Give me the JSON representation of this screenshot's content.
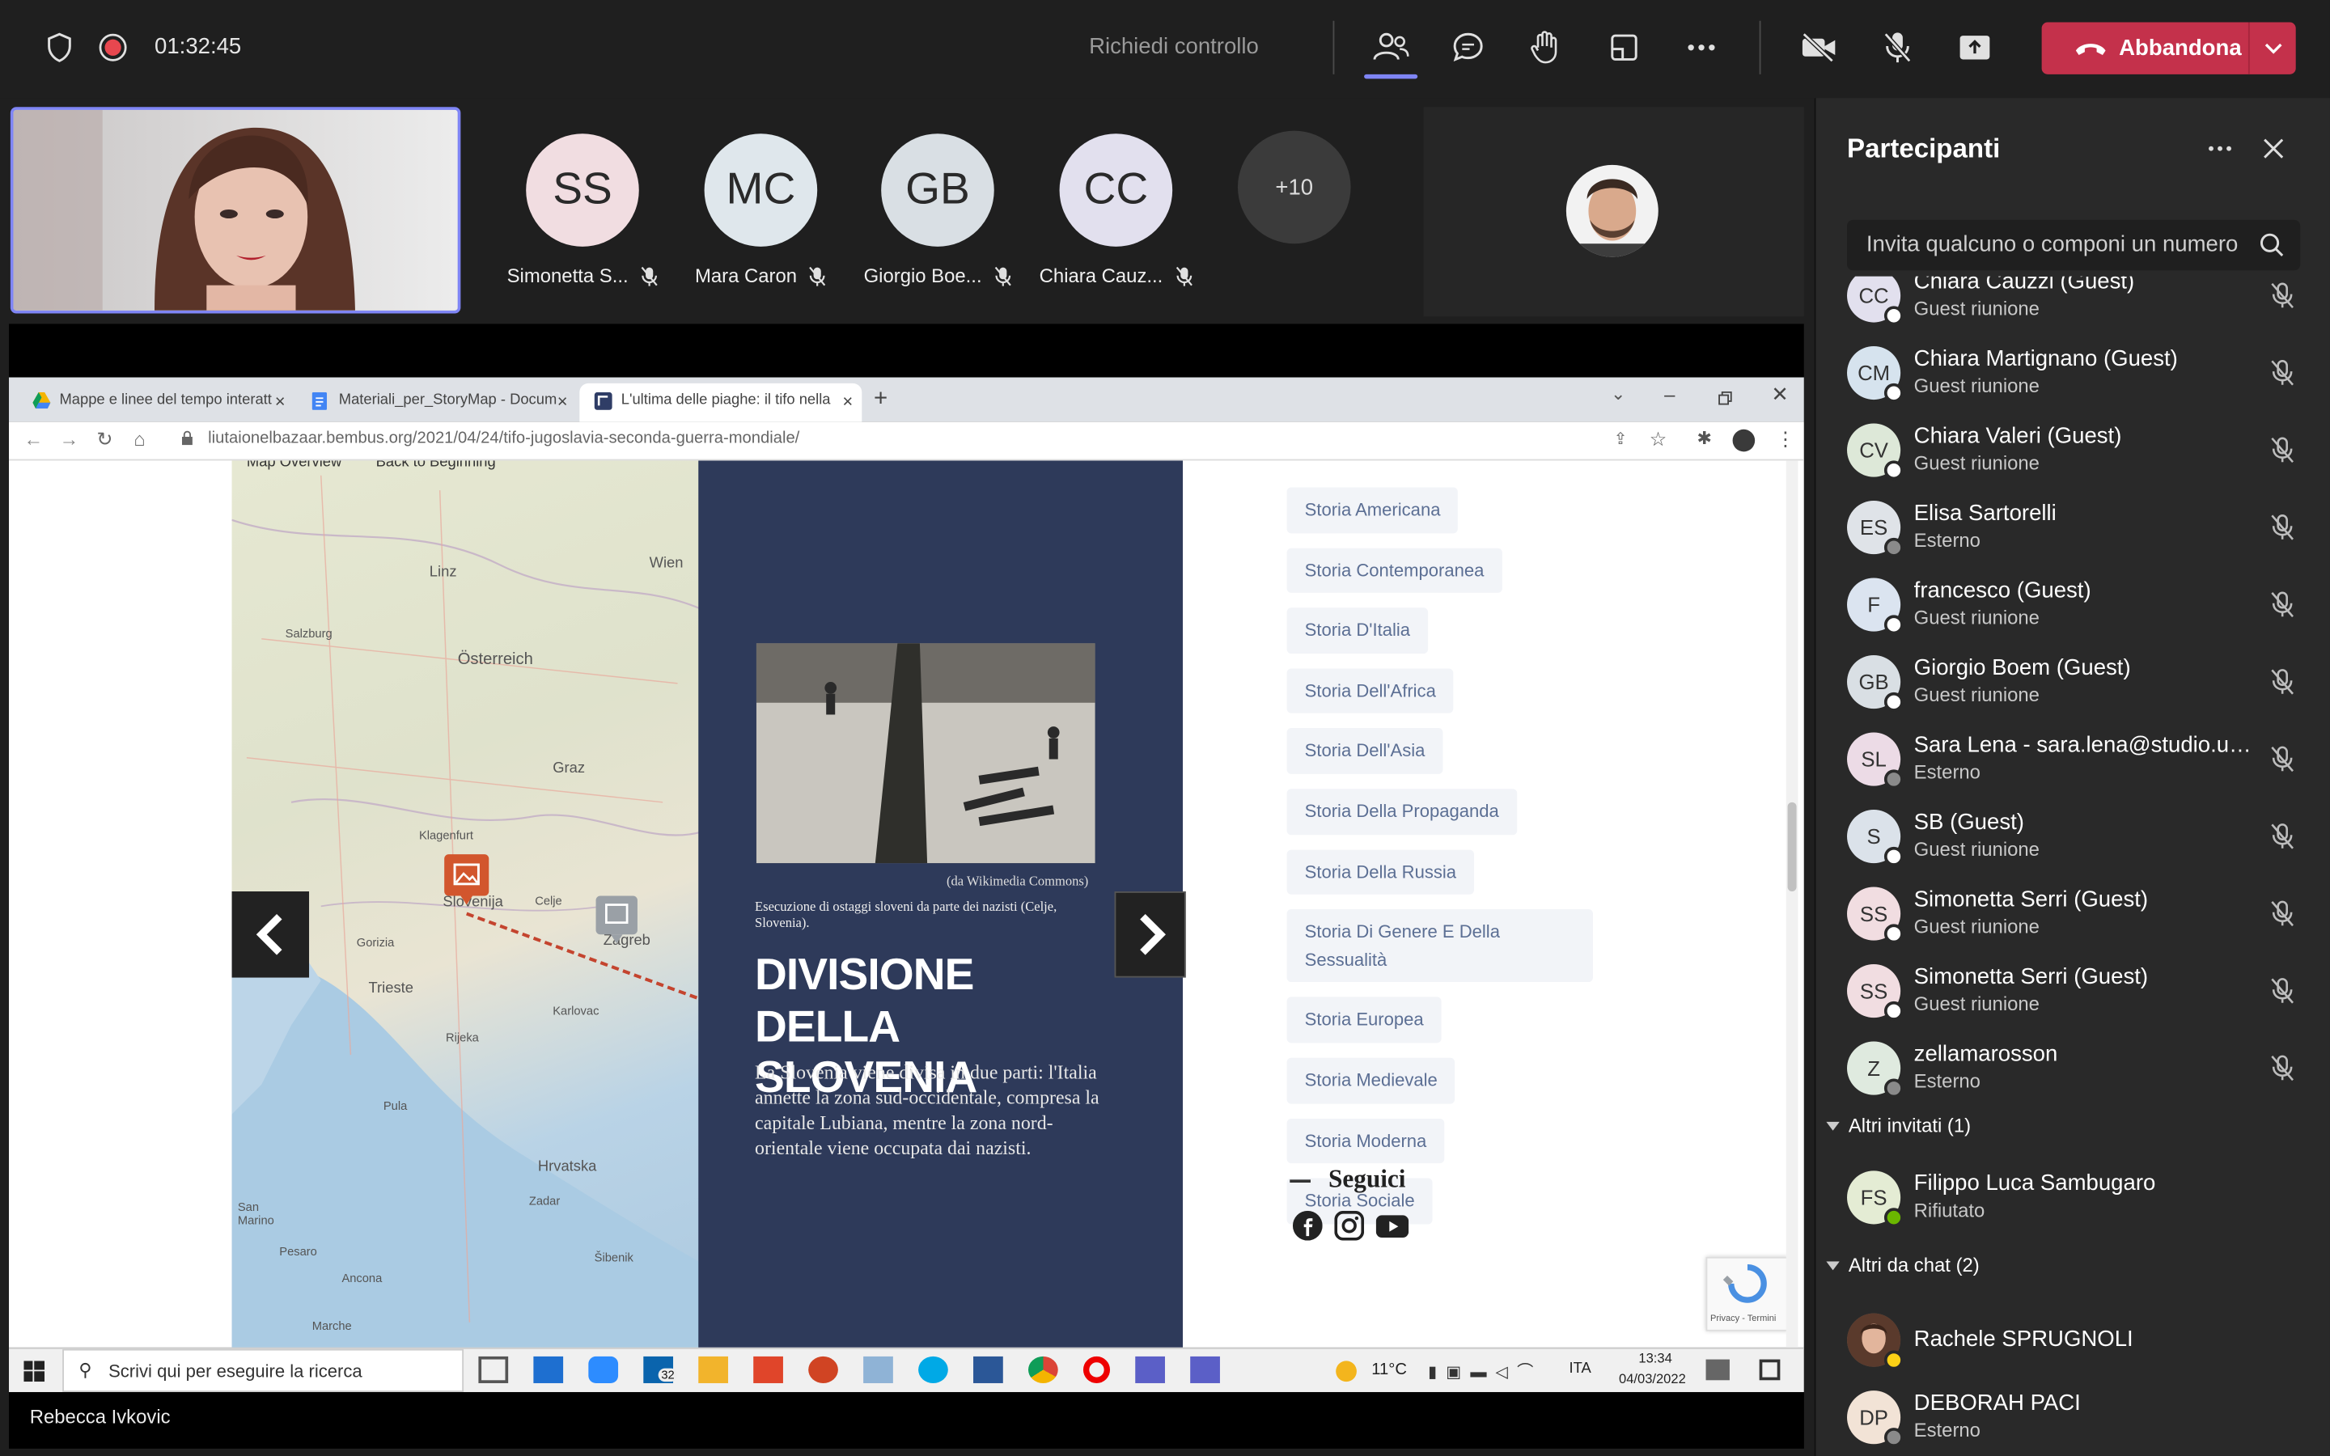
{
  "toolbar": {
    "timer": "01:32:45",
    "request_control": "Richiedi controllo",
    "leave_label": "Abbandona",
    "colors": {
      "leave": "#c4314b",
      "accent": "#7f85f5"
    }
  },
  "stage": {
    "tiles": [
      {
        "initials": "SS",
        "name": "Simonetta S...",
        "color": "#f1dde1"
      },
      {
        "initials": "MC",
        "name": "Mara Caron",
        "color": "#dfe7ec"
      },
      {
        "initials": "GB",
        "name": "Giorgio Boe...",
        "color": "#d9dfe4"
      },
      {
        "initials": "CC",
        "name": "Chiara Cauz...",
        "color": "#e2e0ee"
      }
    ],
    "more_count": "+10"
  },
  "shared_screen": {
    "browser": {
      "tabs": [
        "Mappe e linee del tempo interatt",
        "Materiali_per_StoryMap - Docum",
        "L'ultima delle piaghe: il tifo nella"
      ],
      "url": "liutaionelbazaar.bembus.org/2021/04/24/tifo-jugoslavia-seconda-guerra-mondiale/"
    },
    "map": {
      "top_labels": [
        "Map Overview",
        "Back to Beginning"
      ],
      "places": [
        "Linz",
        "Wien",
        "Österreich",
        "Salzburg",
        "Graz",
        "Klagenfurt",
        "Slovenija",
        "Celje",
        "Zagreb",
        "Gorizia",
        "Trieste",
        "Rijeka",
        "Karlovac",
        "Pula",
        "Hrvatska",
        "Zadar",
        "Ancona",
        "San Marino",
        "Pesaro",
        "Šibenik",
        "Marche"
      ]
    },
    "story": {
      "image_caption": "(da Wikimedia Commons)",
      "image_desc": "Esecuzione di ostaggi sloveni da parte dei nazisti (Celje, Slovenia).",
      "title": "DIVISIONE DELLA SLOVENIA",
      "body": "La Slovenia viene divisa in due parti: l'Italia annette la zona sud-occidentale, compresa la capitale Lubiana, mentre la zona nord-orientale viene occupata dai nazisti."
    },
    "categories": [
      "Storia Americana",
      "Storia Contemporanea",
      "Storia D'Italia",
      "Storia Dell'Africa",
      "Storia Dell'Asia",
      "Storia Della Propaganda",
      "Storia Della Russia",
      "Storia Di Genere E Della Sessualità",
      "Storia Europea",
      "Storia Medievale",
      "Storia Moderna",
      "Storia Sociale"
    ],
    "follow_label": "Seguici",
    "recaptcha": "Privacy - Termini",
    "taskbar": {
      "search_placeholder": "Scrivi qui per eseguire la ricerca",
      "mail_badge": "32",
      "temperature": "11°C",
      "lang": "ITA",
      "time": "13:34",
      "date": "04/03/2022"
    },
    "presenter": "Rebecca Ivkovic"
  },
  "panel": {
    "title": "Partecipanti",
    "invite_placeholder": "Invita qualcuno o componi un numero",
    "participants": [
      {
        "initials": "CC",
        "name": "Chiara Cauzzi (Guest)",
        "role": "Guest riunione",
        "color": "#e2e0ee"
      },
      {
        "initials": "CM",
        "name": "Chiara Martignano (Guest)",
        "role": "Guest riunione",
        "color": "#d6e3ee"
      },
      {
        "initials": "CV",
        "name": "Chiara Valeri (Guest)",
        "role": "Guest riunione",
        "color": "#dde8d8"
      },
      {
        "initials": "ES",
        "name": "Elisa Sartorelli",
        "role": "Esterno",
        "color": "#dfe3e8"
      },
      {
        "initials": "F",
        "name": "francesco (Guest)",
        "role": "Guest riunione",
        "color": "#dbe4f0"
      },
      {
        "initials": "GB",
        "name": "Giorgio Boem (Guest)",
        "role": "Guest riunione",
        "color": "#d9dfe4"
      },
      {
        "initials": "SL",
        "name": "Sara Lena - sara.lena@studio.uni...",
        "role": "Esterno",
        "color": "#ecdbe6"
      },
      {
        "initials": "S",
        "name": "SB (Guest)",
        "role": "Guest riunione",
        "color": "#dbe2ea"
      },
      {
        "initials": "SS",
        "name": "Simonetta Serri (Guest)",
        "role": "Guest riunione",
        "color": "#f1dde1"
      },
      {
        "initials": "SS",
        "name": "Simonetta Serri (Guest)",
        "role": "Guest riunione",
        "color": "#f1dde1"
      },
      {
        "initials": "Z",
        "name": "zellamarosson",
        "role": "Esterno",
        "color": "#dfeadf"
      }
    ],
    "invited_header": "Altri invitati (1)",
    "invited": {
      "initials": "FS",
      "name": "Filippo Luca Sambugaro",
      "role": "Rifiutato",
      "color": "#e4ecd4"
    },
    "chat_header": "Altri da chat (2)",
    "chat": [
      {
        "initials": "",
        "name": "Rachele SPRUGNOLI",
        "role": ""
      },
      {
        "initials": "DP",
        "name": "DEBORAH PACI",
        "role": "Esterno",
        "color": "#f2e3d6"
      }
    ]
  }
}
